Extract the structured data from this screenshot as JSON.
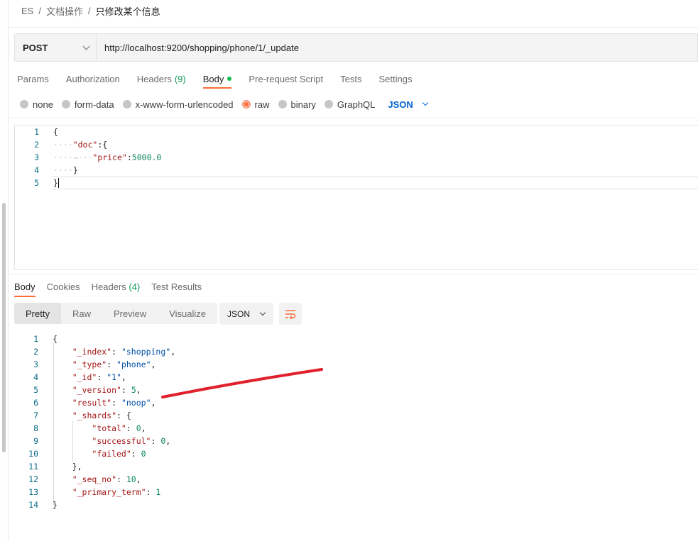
{
  "breadcrumb": {
    "items": [
      "ES",
      "文档操作",
      "只修改某个信息"
    ]
  },
  "request": {
    "method": "POST",
    "url": "http://localhost:9200/shopping/phone/1/_update"
  },
  "request_tabs": {
    "params": "Params",
    "authorization": "Authorization",
    "headers": "Headers",
    "headers_count": "(9)",
    "body": "Body",
    "pre_request": "Pre-request Script",
    "tests": "Tests",
    "settings": "Settings",
    "active": "Body"
  },
  "body_types": {
    "none": "none",
    "form_data": "form-data",
    "urlencoded": "x-www-form-urlencoded",
    "raw": "raw",
    "binary": "binary",
    "graphql": "GraphQL",
    "selected": "raw",
    "language": "JSON"
  },
  "request_body": {
    "line_numbers": [
      "1",
      "2",
      "3",
      "4",
      "5"
    ],
    "open_brace": "{",
    "doc_key": "\"doc\"",
    "doc_punct": ":{",
    "price_key": "\"price\"",
    "price_colon": ":",
    "price_value": "5000.0",
    "inner_close": "}",
    "close_brace": "}"
  },
  "response_tabs": {
    "body": "Body",
    "cookies": "Cookies",
    "headers": "Headers",
    "headers_count": "(4)",
    "test_results": "Test Results",
    "active": "Body"
  },
  "response_view": {
    "pretty": "Pretty",
    "raw": "Raw",
    "preview": "Preview",
    "visualize": "Visualize",
    "active": "Pretty",
    "format": "JSON"
  },
  "response_body": {
    "line_numbers": [
      "1",
      "2",
      "3",
      "4",
      "5",
      "6",
      "7",
      "8",
      "9",
      "10",
      "11",
      "12",
      "13",
      "14"
    ],
    "open_brace": "{",
    "index_key": "\"_index\"",
    "index_value": "\"shopping\"",
    "type_key": "\"_type\"",
    "type_value": "\"phone\"",
    "id_key": "\"_id\"",
    "id_value": "\"1\"",
    "version_key": "\"_version\"",
    "version_value": "5",
    "result_key": "\"result\"",
    "result_value": "\"noop\"",
    "shards_key": "\"_shards\"",
    "shards_open": ": {",
    "total_key": "\"total\"",
    "total_value": "0",
    "successful_key": "\"successful\"",
    "successful_value": "0",
    "failed_key": "\"failed\"",
    "failed_value": "0",
    "shards_close": "},",
    "seq_no_key": "\"_seq_no\"",
    "seq_no_value": "10",
    "primary_term_key": "\"_primary_term\"",
    "primary_term_value": "1",
    "close_brace": "}"
  },
  "colors": {
    "accent": "#ff6c37",
    "link_blue": "#0265d2",
    "count_green": "#0f9d58",
    "annotation_red": "#e0202a"
  }
}
